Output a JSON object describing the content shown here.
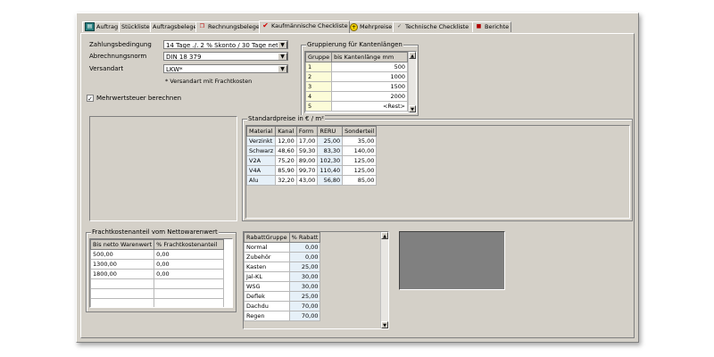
{
  "tabs": [
    {
      "label": "Auftrag",
      "icon": "document-icon"
    },
    {
      "label": "Stückliste",
      "icon": ""
    },
    {
      "label": "Auftragsbelege",
      "icon": ""
    },
    {
      "label": "Rechnungsbelege",
      "icon": "invoice-icon"
    },
    {
      "label": "Kaufmännische Checkliste",
      "icon": "checkmark-icon"
    },
    {
      "label": "Mehrpreise",
      "icon": "plus-coin-icon"
    },
    {
      "label": "Technische Checkliste",
      "icon": "checkmark-icon"
    },
    {
      "label": "Berichte",
      "icon": "truck-icon"
    }
  ],
  "form": {
    "zahlung_label": "Zahlungsbedingung",
    "zahlung_value": "14 Tage ./. 2 % Skonto / 30 Tage netto",
    "abrechnung_label": "Abrechnungsnorm",
    "abrechnung_value": "DIN 18 379",
    "versand_label": "Versandart",
    "versand_value": "LKW*",
    "versand_note": "* Versandart mit Frachtkosten",
    "mwst_label": "Mehrwertsteuer berechnen",
    "mwst_checked": "✓"
  },
  "gruppierung": {
    "title": "Gruppierung für Kantenlängen",
    "headers": [
      "Gruppe",
      "bis Kantenlänge mm"
    ],
    "rows": [
      [
        "1",
        "500"
      ],
      [
        "2",
        "1000"
      ],
      [
        "3",
        "1500"
      ],
      [
        "4",
        "2000"
      ],
      [
        "5",
        "<Rest>"
      ]
    ]
  },
  "standardpreise": {
    "title": "Standardpreise in € / m²",
    "headers": [
      "Material",
      "Kanal",
      "Form",
      "RERU",
      "Sonderteil"
    ],
    "rows": [
      [
        "Verzinkt",
        "12,00",
        "17,00",
        "25,00",
        "35,00"
      ],
      [
        "Schwarz",
        "48,60",
        "59,30",
        "83,30",
        "140,00"
      ],
      [
        "V2A",
        "75,20",
        "89,00",
        "102,30",
        "125,00"
      ],
      [
        "V4A",
        "85,90",
        "99,70",
        "110,40",
        "125,00"
      ],
      [
        "Alu",
        "32,20",
        "43,00",
        "56,80",
        "85,00"
      ]
    ]
  },
  "fracht": {
    "title": "Frachtkostenanteil vom Nettowarenwert",
    "headers": [
      "Bis netto Warenwert",
      "% Frachtkostenanteil"
    ],
    "rows": [
      [
        "500,00",
        "0,00"
      ],
      [
        "1300,00",
        "0,00"
      ],
      [
        "1800,00",
        "0,00"
      ]
    ]
  },
  "rabatt": {
    "headers": [
      "RabattGruppe",
      "% Rabatt"
    ],
    "rows": [
      [
        "Normal",
        "0,00"
      ],
      [
        "Zubehör",
        "0,00"
      ],
      [
        "Kasten",
        "25,00"
      ],
      [
        "Jal-KL",
        "30,00"
      ],
      [
        "WSG",
        "30,00"
      ],
      [
        "Deflek",
        "25,00"
      ],
      [
        "Dachdu",
        "70,00"
      ],
      [
        "Regen",
        "70,00"
      ]
    ]
  },
  "colors": {
    "window_bg": "#d4d0c8",
    "highlight_cell": "#e6f0f8",
    "image_box": "#808080"
  }
}
